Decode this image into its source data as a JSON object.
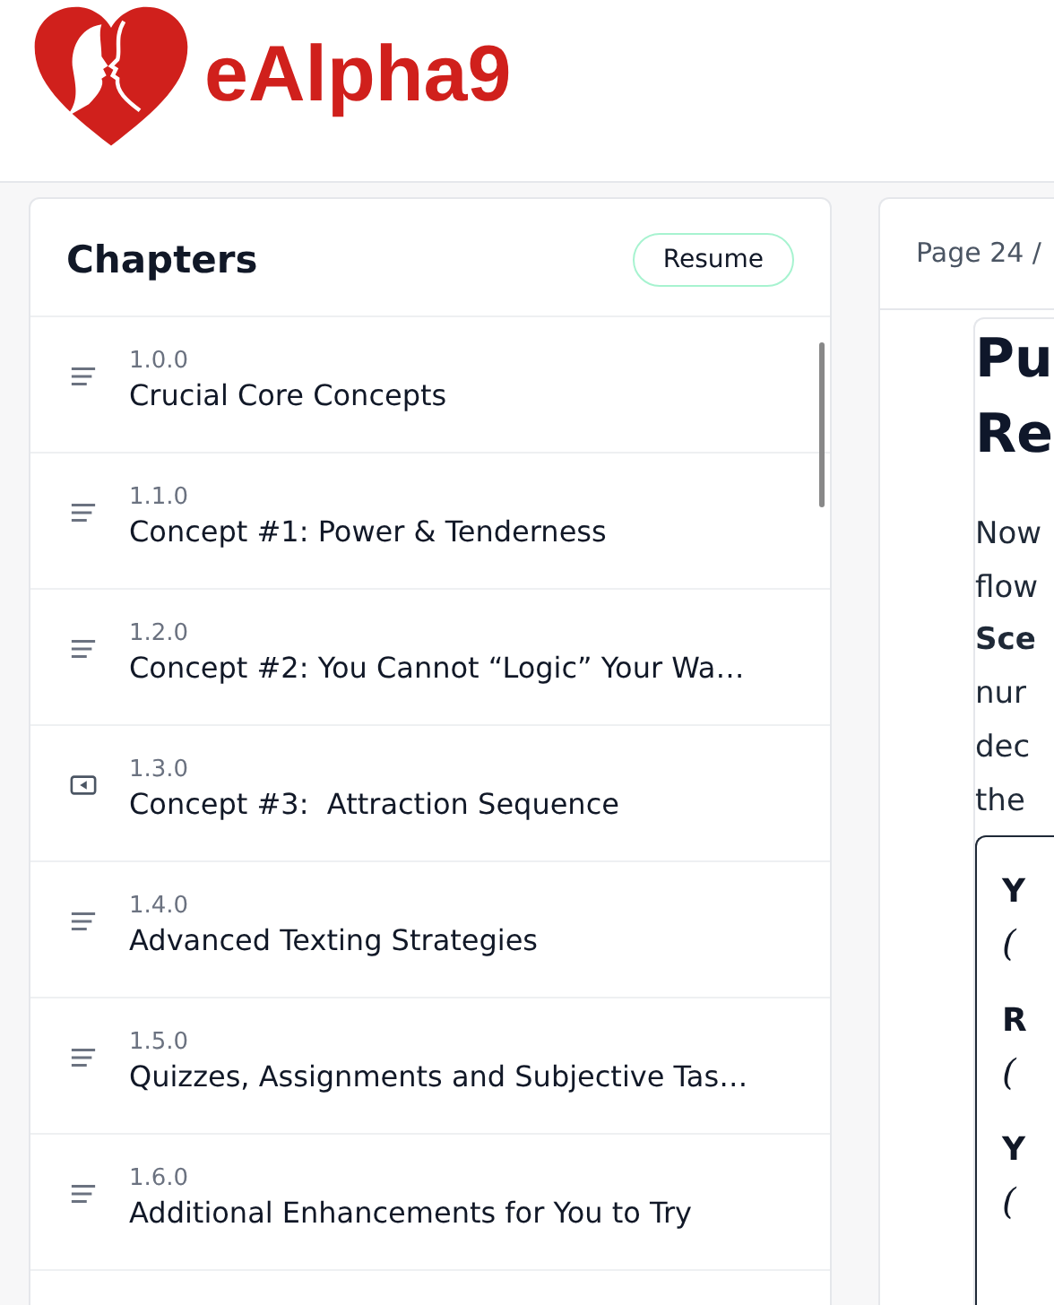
{
  "brand": {
    "name": "eAlpha9"
  },
  "chapters": {
    "title": "Chapters",
    "resume_button": "Resume",
    "items": [
      {
        "number": "1.0.0",
        "title": "Crucial Core Concepts",
        "kind": "text"
      },
      {
        "number": "1.1.0",
        "title": "Concept #1: Power & Tenderness",
        "kind": "text"
      },
      {
        "number": "1.2.0",
        "title": "Concept #2: You Cannot “Logic” Your Wa…",
        "kind": "text"
      },
      {
        "number": "1.3.0",
        "title": "Concept #3:  Attraction Sequence",
        "kind": "video"
      },
      {
        "number": "1.4.0",
        "title": "Advanced Texting Strategies",
        "kind": "text"
      },
      {
        "number": "1.5.0",
        "title": "Quizzes, Assignments and Subjective Tas…",
        "kind": "text"
      },
      {
        "number": "1.6.0",
        "title": "Additional Enhancements for You to Try",
        "kind": "text"
      }
    ]
  },
  "reader": {
    "page_label": "Page 24 /",
    "heading_lines": [
      "Pu",
      "Re"
    ],
    "paragraph_lines": [
      "Now",
      "flow",
      "**Sce**",
      "nur",
      "dec",
      "the"
    ],
    "example_box": [
      {
        "label": "Y",
        "note": "("
      },
      {
        "label": "R",
        "note": "("
      },
      {
        "label": "Y",
        "note": "("
      }
    ]
  }
}
